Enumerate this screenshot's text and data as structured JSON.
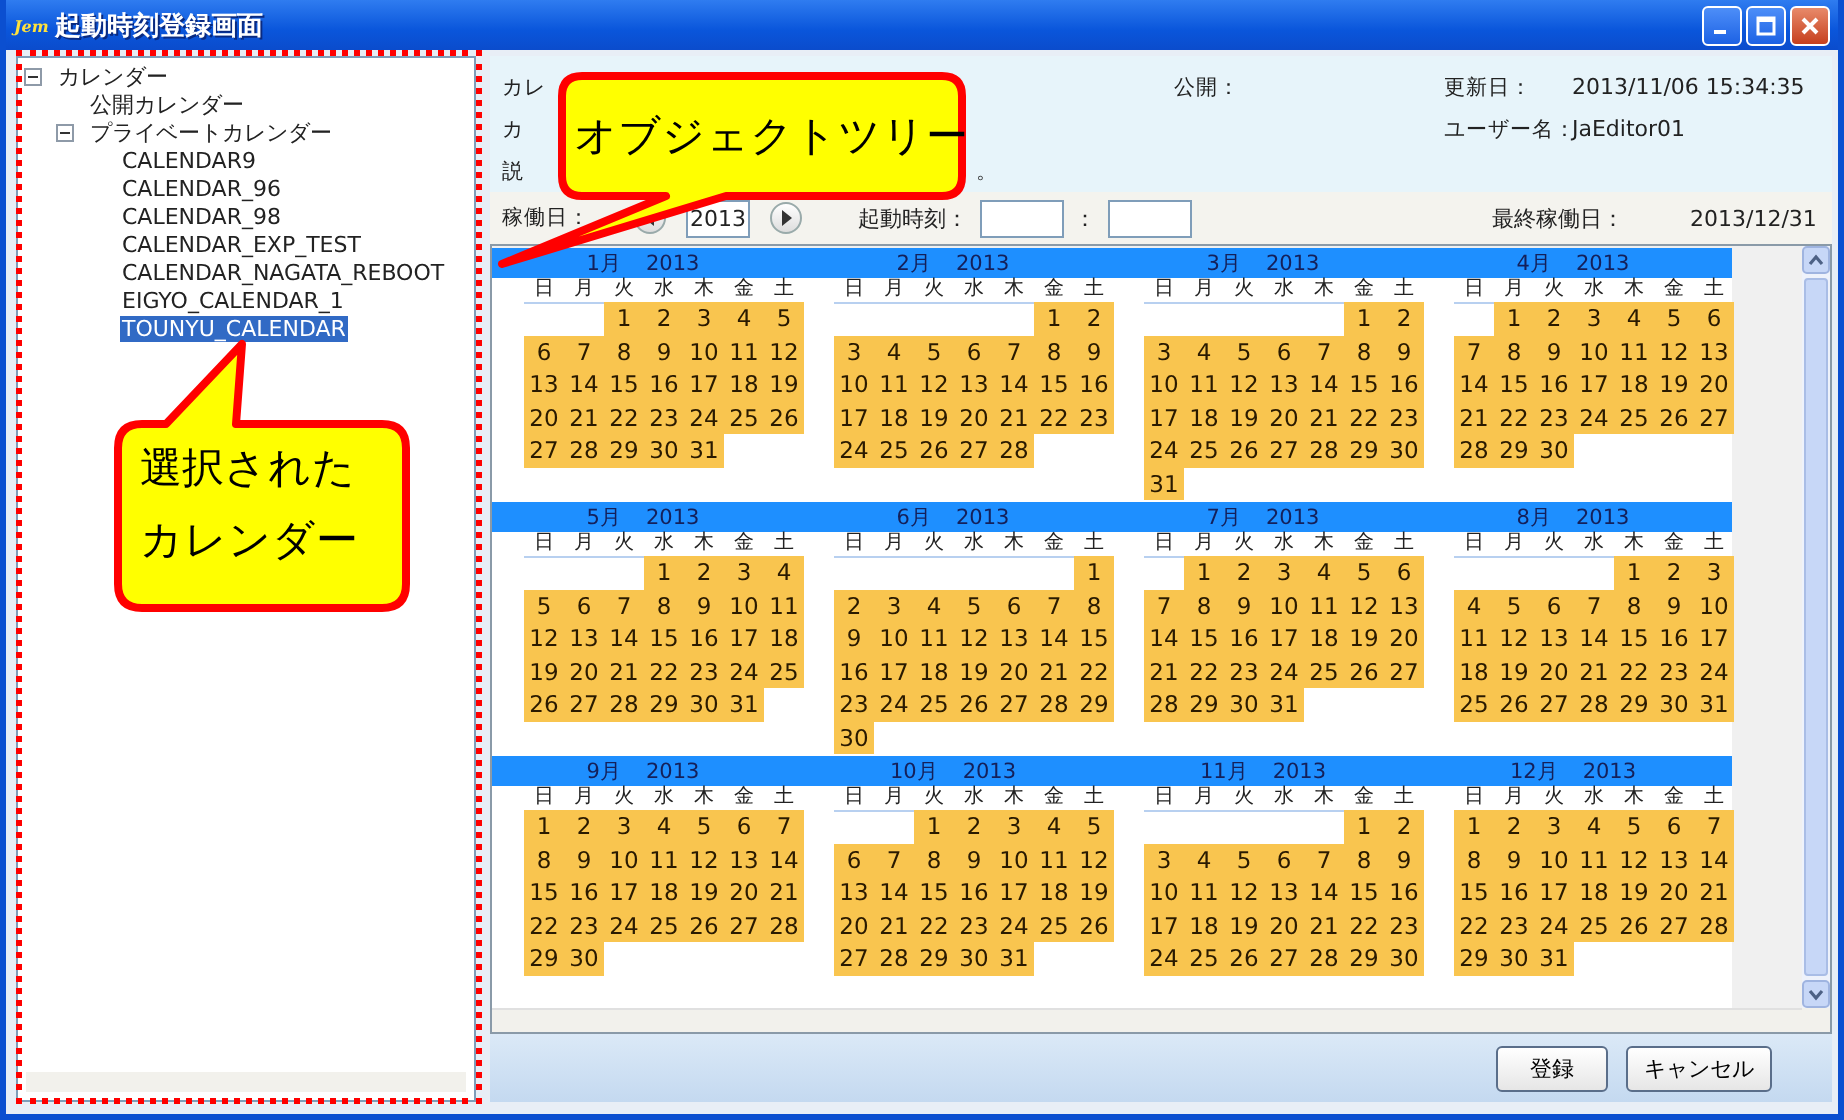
{
  "window": {
    "app_badge": "Jem",
    "title": "起動時刻登録画面"
  },
  "tree": {
    "items": [
      {
        "label": "カレンダー",
        "expanded": true,
        "selected": false,
        "children": [
          {
            "label": "公開カレンダー",
            "selected": false
          },
          {
            "label": "プライベートカレンダー",
            "expanded": true,
            "selected": false,
            "children": [
              {
                "label": "CALENDAR9",
                "selected": false
              },
              {
                "label": "CALENDAR_96",
                "selected": false
              },
              {
                "label": "CALENDAR_98",
                "selected": false
              },
              {
                "label": "CALENDAR_EXP_TEST",
                "selected": false
              },
              {
                "label": "CALENDAR_NAGATA_REBOOT",
                "selected": false
              },
              {
                "label": "EIGYO_CALENDAR_1",
                "selected": false
              },
              {
                "label": "TOUNYU_CALENDAR",
                "selected": true
              }
            ]
          }
        ]
      }
    ]
  },
  "info": {
    "row1_label": "カレ",
    "public_label": "公開：",
    "updated_label": "更新日：",
    "updated": "2013/11/06 15:34:35",
    "row2_label": "カ",
    "user_label": "ユーザー名：",
    "user": "JaEditor01",
    "row3_label": "説",
    "row3_tail": "。"
  },
  "controls": {
    "operating_label": "稼働日：",
    "year": "2013",
    "start_time_label": "起動時刻：",
    "separator": "：",
    "last_day_label": "最終稼働日：",
    "last_day": "2013/12/31"
  },
  "calendar": {
    "months": [
      {
        "month": "1月",
        "year": "2013",
        "weekdays": [
          "日",
          "月",
          "火",
          "水",
          "木",
          "金",
          "土"
        ],
        "weeks": [
          [
            "1",
            "2",
            "3",
            "4",
            "5"
          ],
          [
            "6",
            "7",
            "8",
            "9",
            "10",
            "11",
            "12"
          ],
          [
            "13",
            "14",
            "15",
            "16",
            "17",
            "18",
            "19"
          ],
          [
            "20",
            "21",
            "22",
            "23",
            "24",
            "25",
            "26"
          ],
          [
            "27",
            "28",
            "29",
            "30",
            "31"
          ]
        ]
      },
      {
        "month": "2月",
        "year": "2013",
        "weekdays": [
          "日",
          "月",
          "火",
          "水",
          "木",
          "金",
          "土"
        ],
        "weeks": [
          [
            "1",
            "2"
          ],
          [
            "3",
            "4",
            "5",
            "6",
            "7",
            "8",
            "9"
          ],
          [
            "10",
            "11",
            "12",
            "13",
            "14",
            "15",
            "16"
          ],
          [
            "17",
            "18",
            "19",
            "20",
            "21",
            "22",
            "23"
          ],
          [
            "24",
            "25",
            "26",
            "27",
            "28"
          ]
        ]
      },
      {
        "month": "3月",
        "year": "2013",
        "weekdays": [
          "日",
          "月",
          "火",
          "水",
          "木",
          "金",
          "土"
        ],
        "weeks": [
          [
            "1",
            "2"
          ],
          [
            "3",
            "4",
            "5",
            "6",
            "7",
            "8",
            "9"
          ],
          [
            "10",
            "11",
            "12",
            "13",
            "14",
            "15",
            "16"
          ],
          [
            "17",
            "18",
            "19",
            "20",
            "21",
            "22",
            "23"
          ],
          [
            "24",
            "25",
            "26",
            "27",
            "28",
            "29",
            "30"
          ],
          [
            "31"
          ]
        ]
      },
      {
        "month": "4月",
        "year": "2013",
        "weekdays": [
          "日",
          "月",
          "火",
          "水",
          "木",
          "金",
          "土"
        ],
        "weeks": [
          [
            "1",
            "2",
            "3",
            "4",
            "5",
            "6"
          ],
          [
            "7",
            "8",
            "9",
            "10",
            "11",
            "12",
            "13"
          ],
          [
            "14",
            "15",
            "16",
            "17",
            "18",
            "19",
            "20"
          ],
          [
            "21",
            "22",
            "23",
            "24",
            "25",
            "26",
            "27"
          ],
          [
            "28",
            "29",
            "30"
          ]
        ]
      },
      {
        "month": "5月",
        "year": "2013",
        "weekdays": [
          "日",
          "月",
          "火",
          "水",
          "木",
          "金",
          "土"
        ],
        "weeks": [
          [
            "1",
            "2",
            "3",
            "4"
          ],
          [
            "5",
            "6",
            "7",
            "8",
            "9",
            "10",
            "11"
          ],
          [
            "12",
            "13",
            "14",
            "15",
            "16",
            "17",
            "18"
          ],
          [
            "19",
            "20",
            "21",
            "22",
            "23",
            "24",
            "25"
          ],
          [
            "26",
            "27",
            "28",
            "29",
            "30",
            "31"
          ]
        ]
      },
      {
        "month": "6月",
        "year": "2013",
        "weekdays": [
          "日",
          "月",
          "火",
          "水",
          "木",
          "金",
          "土"
        ],
        "weeks": [
          [
            "1"
          ],
          [
            "2",
            "3",
            "4",
            "5",
            "6",
            "7",
            "8"
          ],
          [
            "9",
            "10",
            "11",
            "12",
            "13",
            "14",
            "15"
          ],
          [
            "16",
            "17",
            "18",
            "19",
            "20",
            "21",
            "22"
          ],
          [
            "23",
            "24",
            "25",
            "26",
            "27",
            "28",
            "29"
          ],
          [
            "30"
          ]
        ]
      },
      {
        "month": "7月",
        "year": "2013",
        "weekdays": [
          "日",
          "月",
          "火",
          "水",
          "木",
          "金",
          "土"
        ],
        "weeks": [
          [
            "1",
            "2",
            "3",
            "4",
            "5",
            "6"
          ],
          [
            "7",
            "8",
            "9",
            "10",
            "11",
            "12",
            "13"
          ],
          [
            "14",
            "15",
            "16",
            "17",
            "18",
            "19",
            "20"
          ],
          [
            "21",
            "22",
            "23",
            "24",
            "25",
            "26",
            "27"
          ],
          [
            "28",
            "29",
            "30",
            "31"
          ]
        ]
      },
      {
        "month": "8月",
        "year": "2013",
        "weekdays": [
          "日",
          "月",
          "火",
          "水",
          "木",
          "金",
          "土"
        ],
        "weeks": [
          [
            "1",
            "2",
            "3"
          ],
          [
            "4",
            "5",
            "6",
            "7",
            "8",
            "9",
            "10"
          ],
          [
            "11",
            "12",
            "13",
            "14",
            "15",
            "16",
            "17"
          ],
          [
            "18",
            "19",
            "20",
            "21",
            "22",
            "23",
            "24"
          ],
          [
            "25",
            "26",
            "27",
            "28",
            "29",
            "30",
            "31"
          ]
        ]
      },
      {
        "month": "9月",
        "year": "2013",
        "weekdays": [
          "日",
          "月",
          "火",
          "水",
          "木",
          "金",
          "土"
        ],
        "weeks": [
          [
            "1",
            "2",
            "3",
            "4",
            "5",
            "6",
            "7"
          ],
          [
            "8",
            "9",
            "10",
            "11",
            "12",
            "13",
            "14"
          ],
          [
            "15",
            "16",
            "17",
            "18",
            "19",
            "20",
            "21"
          ],
          [
            "22",
            "23",
            "24",
            "25",
            "26",
            "27",
            "28"
          ],
          [
            "29",
            "30"
          ]
        ]
      },
      {
        "month": "10月",
        "year": "2013",
        "weekdays": [
          "日",
          "月",
          "火",
          "水",
          "木",
          "金",
          "土"
        ],
        "weeks": [
          [
            "1",
            "2",
            "3",
            "4",
            "5"
          ],
          [
            "6",
            "7",
            "8",
            "9",
            "10",
            "11",
            "12"
          ],
          [
            "13",
            "14",
            "15",
            "16",
            "17",
            "18",
            "19"
          ],
          [
            "20",
            "21",
            "22",
            "23",
            "24",
            "25",
            "26"
          ],
          [
            "27",
            "28",
            "29",
            "30",
            "31"
          ]
        ]
      },
      {
        "month": "11月",
        "year": "2013",
        "weekdays": [
          "日",
          "月",
          "火",
          "水",
          "木",
          "金",
          "土"
        ],
        "weeks": [
          [
            "1",
            "2"
          ],
          [
            "3",
            "4",
            "5",
            "6",
            "7",
            "8",
            "9"
          ],
          [
            "10",
            "11",
            "12",
            "13",
            "14",
            "15",
            "16"
          ],
          [
            "17",
            "18",
            "19",
            "20",
            "21",
            "22",
            "23"
          ],
          [
            "24",
            "25",
            "26",
            "27",
            "28",
            "29",
            "30"
          ]
        ]
      },
      {
        "month": "12月",
        "year": "2013",
        "weekdays": [
          "日",
          "月",
          "火",
          "水",
          "木",
          "金",
          "土"
        ],
        "weeks": [
          [
            "1",
            "2",
            "3",
            "4",
            "5",
            "6",
            "7"
          ],
          [
            "8",
            "9",
            "10",
            "11",
            "12",
            "13",
            "14"
          ],
          [
            "15",
            "16",
            "17",
            "18",
            "19",
            "20",
            "21"
          ],
          [
            "22",
            "23",
            "24",
            "25",
            "26",
            "27",
            "28"
          ],
          [
            "29",
            "30",
            "31"
          ]
        ]
      }
    ]
  },
  "buttons": [
    "登録",
    "キャンセル"
  ],
  "callouts": [
    {
      "lines": [
        "オブジェクトツリー"
      ]
    },
    {
      "lines": [
        "選択された",
        "カレンダー"
      ]
    }
  ]
}
